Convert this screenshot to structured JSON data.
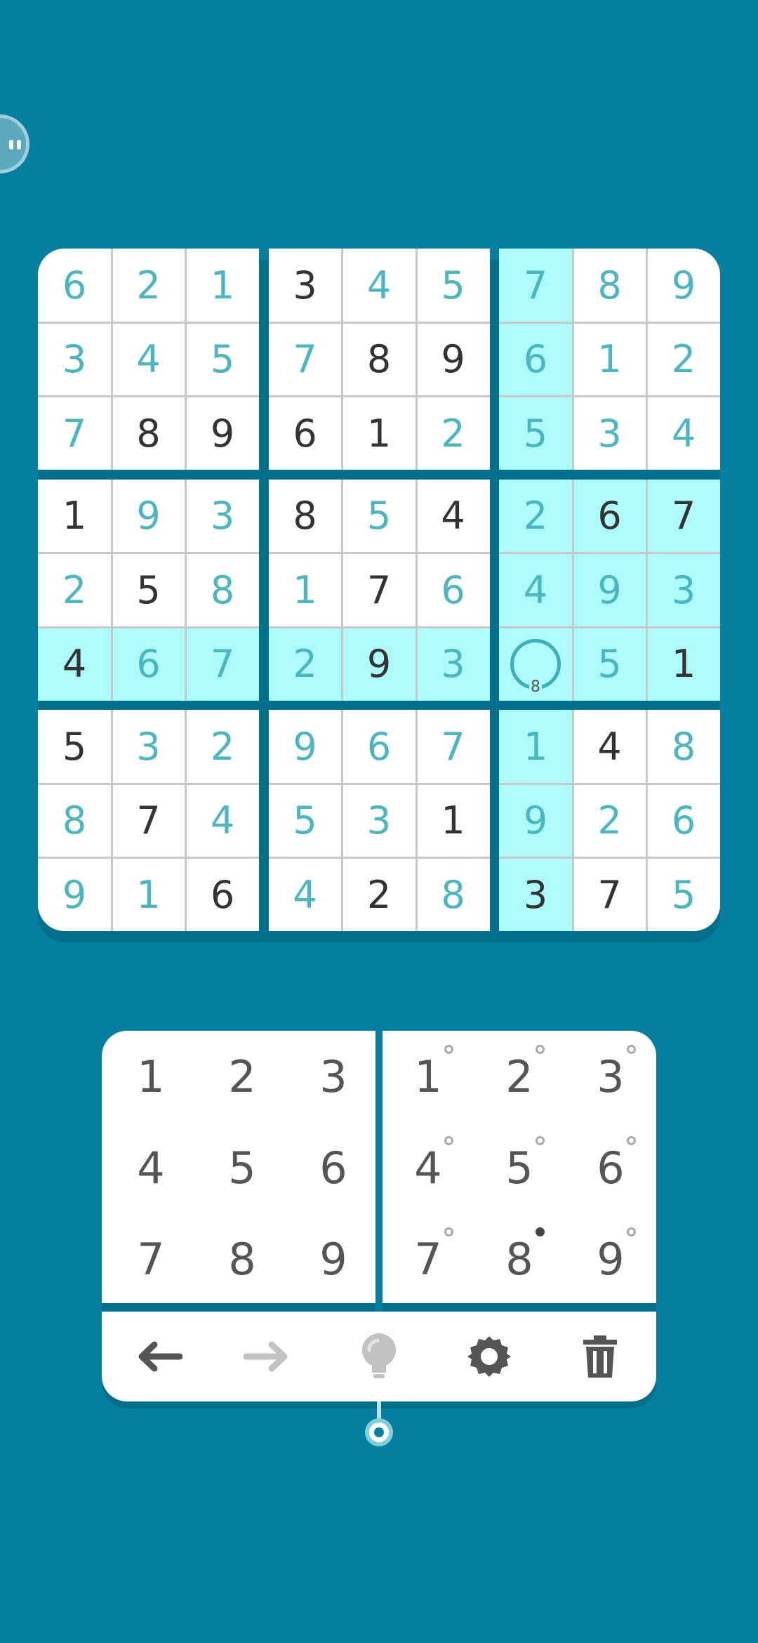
{
  "grid": [
    [
      {
        "v": "6",
        "t": "user"
      },
      {
        "v": "2",
        "t": "user"
      },
      {
        "v": "1",
        "t": "user"
      },
      {
        "v": "3",
        "t": "given"
      },
      {
        "v": "4",
        "t": "user"
      },
      {
        "v": "5",
        "t": "user"
      },
      {
        "v": "7",
        "t": "user"
      },
      {
        "v": "8",
        "t": "user"
      },
      {
        "v": "9",
        "t": "user"
      }
    ],
    [
      {
        "v": "3",
        "t": "user"
      },
      {
        "v": "4",
        "t": "user"
      },
      {
        "v": "5",
        "t": "user"
      },
      {
        "v": "7",
        "t": "user"
      },
      {
        "v": "8",
        "t": "given"
      },
      {
        "v": "9",
        "t": "given"
      },
      {
        "v": "6",
        "t": "user"
      },
      {
        "v": "1",
        "t": "user"
      },
      {
        "v": "2",
        "t": "user"
      }
    ],
    [
      {
        "v": "7",
        "t": "user"
      },
      {
        "v": "8",
        "t": "given"
      },
      {
        "v": "9",
        "t": "given"
      },
      {
        "v": "6",
        "t": "given"
      },
      {
        "v": "1",
        "t": "given"
      },
      {
        "v": "2",
        "t": "user"
      },
      {
        "v": "5",
        "t": "user"
      },
      {
        "v": "3",
        "t": "user"
      },
      {
        "v": "4",
        "t": "user"
      }
    ],
    [
      {
        "v": "1",
        "t": "given"
      },
      {
        "v": "9",
        "t": "user"
      },
      {
        "v": "3",
        "t": "user"
      },
      {
        "v": "8",
        "t": "given"
      },
      {
        "v": "5",
        "t": "user"
      },
      {
        "v": "4",
        "t": "given"
      },
      {
        "v": "2",
        "t": "user"
      },
      {
        "v": "6",
        "t": "given"
      },
      {
        "v": "7",
        "t": "given"
      }
    ],
    [
      {
        "v": "2",
        "t": "user"
      },
      {
        "v": "5",
        "t": "given"
      },
      {
        "v": "8",
        "t": "user"
      },
      {
        "v": "1",
        "t": "user"
      },
      {
        "v": "7",
        "t": "given"
      },
      {
        "v": "6",
        "t": "user"
      },
      {
        "v": "4",
        "t": "user"
      },
      {
        "v": "9",
        "t": "user"
      },
      {
        "v": "3",
        "t": "user"
      }
    ],
    [
      {
        "v": "4",
        "t": "given"
      },
      {
        "v": "6",
        "t": "user"
      },
      {
        "v": "7",
        "t": "user"
      },
      {
        "v": "2",
        "t": "user"
      },
      {
        "v": "9",
        "t": "given"
      },
      {
        "v": "3",
        "t": "user"
      },
      {
        "v": "",
        "t": "selected",
        "note": "8"
      },
      {
        "v": "5",
        "t": "user"
      },
      {
        "v": "1",
        "t": "given"
      }
    ],
    [
      {
        "v": "5",
        "t": "given"
      },
      {
        "v": "3",
        "t": "user"
      },
      {
        "v": "2",
        "t": "user"
      },
      {
        "v": "9",
        "t": "user"
      },
      {
        "v": "6",
        "t": "user"
      },
      {
        "v": "7",
        "t": "user"
      },
      {
        "v": "1",
        "t": "user"
      },
      {
        "v": "4",
        "t": "given"
      },
      {
        "v": "8",
        "t": "user"
      }
    ],
    [
      {
        "v": "8",
        "t": "user"
      },
      {
        "v": "7",
        "t": "given"
      },
      {
        "v": "4",
        "t": "user"
      },
      {
        "v": "5",
        "t": "user"
      },
      {
        "v": "3",
        "t": "user"
      },
      {
        "v": "1",
        "t": "given"
      },
      {
        "v": "9",
        "t": "user"
      },
      {
        "v": "2",
        "t": "user"
      },
      {
        "v": "6",
        "t": "user"
      }
    ],
    [
      {
        "v": "9",
        "t": "user"
      },
      {
        "v": "1",
        "t": "user"
      },
      {
        "v": "6",
        "t": "given"
      },
      {
        "v": "4",
        "t": "user"
      },
      {
        "v": "2",
        "t": "given"
      },
      {
        "v": "8",
        "t": "user"
      },
      {
        "v": "3",
        "t": "given"
      },
      {
        "v": "7",
        "t": "given"
      },
      {
        "v": "5",
        "t": "user"
      }
    ]
  ],
  "selected": {
    "row": 5,
    "col": 6
  },
  "number_pad": [
    "1",
    "2",
    "3",
    "4",
    "5",
    "6",
    "7",
    "8",
    "9"
  ],
  "notes_pad": [
    {
      "label": "1",
      "mark": "empty"
    },
    {
      "label": "2",
      "mark": "empty"
    },
    {
      "label": "3",
      "mark": "empty"
    },
    {
      "label": "4",
      "mark": "empty"
    },
    {
      "label": "5",
      "mark": "empty"
    },
    {
      "label": "6",
      "mark": "empty"
    },
    {
      "label": "7",
      "mark": "empty"
    },
    {
      "label": "8",
      "mark": "filled"
    },
    {
      "label": "9",
      "mark": "empty"
    }
  ],
  "toolbar": [
    {
      "name": "undo-button",
      "icon": "arrow-left-icon",
      "enabled": true
    },
    {
      "name": "redo-button",
      "icon": "arrow-right-icon",
      "enabled": false
    },
    {
      "name": "hint-button",
      "icon": "lightbulb-icon",
      "enabled": false
    },
    {
      "name": "settings-button",
      "icon": "gear-icon",
      "enabled": true
    },
    {
      "name": "delete-button",
      "icon": "trash-icon",
      "enabled": true
    }
  ],
  "colors": {
    "background": "#047f9f",
    "highlight": "#adfbfb",
    "user_digit": "#4bb6c0",
    "given_digit": "#333333"
  }
}
